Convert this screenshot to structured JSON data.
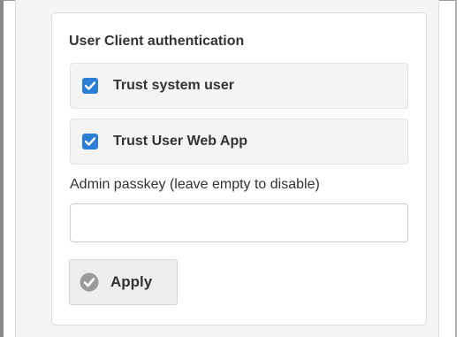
{
  "auth": {
    "title": "User Client authentication",
    "options": [
      {
        "label": "Trust system user",
        "checked": true
      },
      {
        "label": "Trust User Web App",
        "checked": true
      }
    ],
    "passkey": {
      "label": "Admin passkey (leave empty to disable)",
      "value": "",
      "placeholder": ""
    },
    "apply_label": "Apply"
  },
  "colors": {
    "checkbox_accent": "#2c7fd6",
    "apply_icon": "#9b9b9b"
  },
  "icons": {
    "checkbox": "check-icon",
    "apply": "check-circle-icon"
  }
}
